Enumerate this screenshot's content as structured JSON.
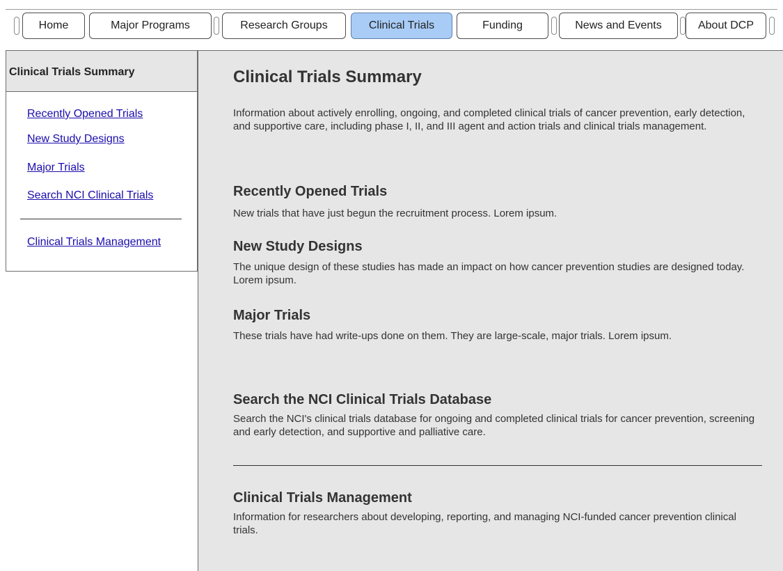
{
  "nav": {
    "tabs": [
      {
        "label": "Home"
      },
      {
        "label": "Major Programs"
      },
      {
        "label": "Research Groups"
      },
      {
        "label": "Clinical Trials",
        "active": true
      },
      {
        "label": "Funding"
      },
      {
        "label": "News and Events"
      },
      {
        "label": "About DCP"
      }
    ]
  },
  "sidebar": {
    "title": "Clinical Trials Summary",
    "links": [
      "Recently Opened Trials",
      "New Study Designs",
      "Major Trials",
      "Search NCI Clinical Trials",
      "Clinical Trials Management"
    ]
  },
  "main": {
    "title": "Clinical Trials Summary",
    "intro": "Information about actively enrolling, ongoing, and completed clinical trials of cancer prevention, early detection, and supportive care, including phase I, II, and III agent and action trials and clinical trials management.",
    "sections": [
      {
        "title": "Recently Opened Trials",
        "description": "New trials that have just begun the recruitment process.  Lorem ipsum."
      },
      {
        "title": "New Study Designs",
        "description": "The unique design of these studies has made an impact on how cancer prevention studies are designed today.  Lorem ipsum."
      },
      {
        "title": "Major Trials",
        "description": "These trials have had write-ups done on them.  They are large-scale, major trials. Lorem ipsum."
      },
      {
        "title": "Search the NCI Clinical Trials Database",
        "description": "Search the NCI's clinical trials database for ongoing and completed clinical trials for cancer prevention, screening and early detection, and supportive and palliative care."
      },
      {
        "title": "Clinical Trials Management",
        "description": "Information for researchers about developing, reporting, and managing NCI-funded cancer prevention clinical trials."
      }
    ]
  },
  "colors": {
    "active_tab": "#a9ccf7",
    "link": "#1a0dab",
    "content_bg": "#e6e6e6"
  }
}
